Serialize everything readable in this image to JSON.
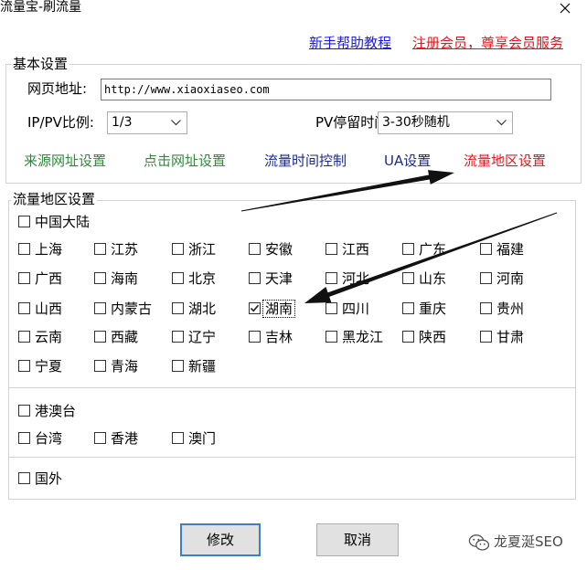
{
  "window": {
    "title": "流量宝-刷流量",
    "close_icon": "close-icon"
  },
  "top_links": {
    "help": {
      "label": "新手帮助教程",
      "color": "#1a1ae6"
    },
    "register": {
      "label": "注册会员，尊享会员服务",
      "color": "#e5161c"
    }
  },
  "basic": {
    "legend": "基本设置",
    "url": {
      "label": "网页地址:",
      "value": "http://www.xiaoxiaseo.com"
    },
    "ratio": {
      "label": "IP/PV比例:",
      "value": "1/3",
      "icon": "chevron-down-icon"
    },
    "stay": {
      "label": "PV停留时间",
      "value": "3-30秒随机",
      "icon": "chevron-down-icon"
    },
    "links": [
      {
        "label": "来源网址设置",
        "color": "#2f8a3a"
      },
      {
        "label": "点击网址设置",
        "color": "#2f8a3a"
      },
      {
        "label": "流量时间控制",
        "color": "#1c2a8c"
      },
      {
        "label": "UA设置",
        "color": "#1c2a8c"
      },
      {
        "label": "流量地区设置",
        "color": "#e5161c"
      }
    ]
  },
  "region": {
    "legend": "流量地区设置",
    "mainland": {
      "label": "中国大陆",
      "checked": false,
      "provinces": [
        {
          "label": "上海",
          "checked": false
        },
        {
          "label": "江苏",
          "checked": false
        },
        {
          "label": "浙江",
          "checked": false
        },
        {
          "label": "安徽",
          "checked": false
        },
        {
          "label": "江西",
          "checked": false
        },
        {
          "label": "广东",
          "checked": false
        },
        {
          "label": "福建",
          "checked": false
        },
        {
          "label": "广西",
          "checked": false
        },
        {
          "label": "海南",
          "checked": false
        },
        {
          "label": "北京",
          "checked": false
        },
        {
          "label": "天津",
          "checked": false
        },
        {
          "label": "河北",
          "checked": false
        },
        {
          "label": "山东",
          "checked": false
        },
        {
          "label": "河南",
          "checked": false
        },
        {
          "label": "山西",
          "checked": false
        },
        {
          "label": "内蒙古",
          "checked": false
        },
        {
          "label": "湖北",
          "checked": false
        },
        {
          "label": "湖南",
          "checked": true,
          "focused": true
        },
        {
          "label": "四川",
          "checked": false
        },
        {
          "label": "重庆",
          "checked": false
        },
        {
          "label": "贵州",
          "checked": false
        },
        {
          "label": "云南",
          "checked": false
        },
        {
          "label": "西藏",
          "checked": false
        },
        {
          "label": "辽宁",
          "checked": false
        },
        {
          "label": "吉林",
          "checked": false
        },
        {
          "label": "黑龙江",
          "checked": false
        },
        {
          "label": "陕西",
          "checked": false
        },
        {
          "label": "甘肃",
          "checked": false
        },
        {
          "label": "宁夏",
          "checked": false
        },
        {
          "label": "青海",
          "checked": false
        },
        {
          "label": "新疆",
          "checked": false
        }
      ]
    },
    "hmt": {
      "label": "港澳台",
      "checked": false,
      "areas": [
        {
          "label": "台湾",
          "checked": false
        },
        {
          "label": "香港",
          "checked": false
        },
        {
          "label": "澳门",
          "checked": false
        }
      ]
    },
    "overseas": {
      "label": "国外",
      "checked": false
    }
  },
  "buttons": {
    "ok": "修改",
    "cancel": "取消"
  },
  "watermark": {
    "text": "龙夏涎SEO",
    "icon": "wechat-icon"
  }
}
